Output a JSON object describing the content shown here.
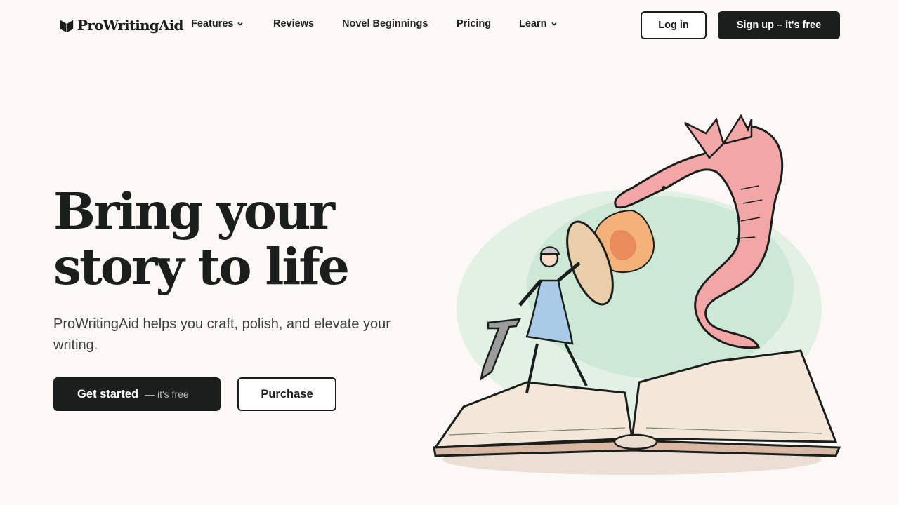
{
  "brand": {
    "name": "ProWritingAid",
    "logo_icon": "book-heart-icon"
  },
  "nav": {
    "items": [
      {
        "label": "Features",
        "has_dropdown": true
      },
      {
        "label": "Reviews",
        "has_dropdown": false
      },
      {
        "label": "Novel Beginnings",
        "has_dropdown": false
      },
      {
        "label": "Pricing",
        "has_dropdown": false
      },
      {
        "label": "Learn",
        "has_dropdown": true
      }
    ],
    "login_label": "Log in",
    "signup_label": "Sign up – it's free"
  },
  "hero": {
    "title_line1": "Bring your",
    "title_line2": "story to life",
    "subtitle": "ProWritingAid helps you craft, polish, and elevate your writing.",
    "cta_primary": "Get started",
    "cta_primary_suffix": "— it's free",
    "cta_secondary": "Purchase"
  },
  "illustration": {
    "description_icon": "dragon-knight-book-illustration"
  },
  "colors": {
    "dark": "#1a1f1d",
    "background": "#fcf8f5",
    "dragon": "#ef9a9a",
    "mist": "#bfe3cb",
    "knight_tunic": "#a9cbe8"
  }
}
